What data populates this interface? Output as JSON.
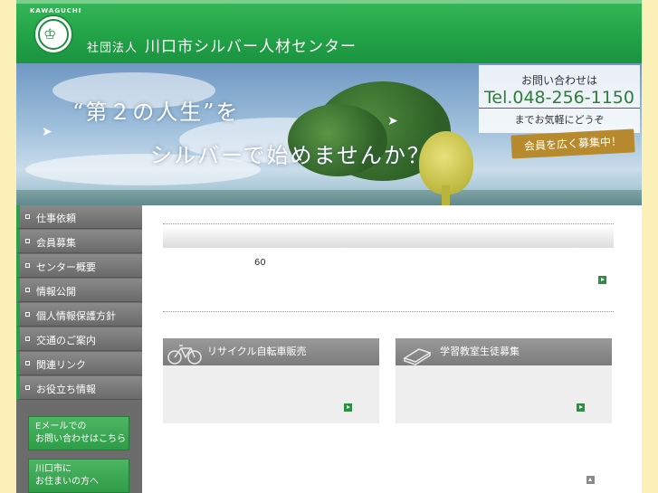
{
  "header": {
    "logo_text": "KAWAGUCHI",
    "org_prefix": "社団法人",
    "org_name": "川口市シルバー人材センター"
  },
  "hero": {
    "line1": "“第２の人生”を",
    "line2": "シルバーで始めませんか？",
    "contact_label": "お問い合わせは",
    "tel": "Tel.048-256-1150",
    "contact_note": "までお気軽にどうぞ",
    "recruit_banner": "会員を広く募集中！"
  },
  "sidebar": {
    "items": [
      {
        "label": "仕事依頼"
      },
      {
        "label": "会員募集"
      },
      {
        "label": "センター概要"
      },
      {
        "label": "情報公開"
      },
      {
        "label": "個人情報保護方針"
      },
      {
        "label": "交通のご案内"
      },
      {
        "label": "関連リンク"
      },
      {
        "label": "お役立ち情報"
      }
    ],
    "email_button": {
      "line1": "Eメールでの",
      "line2": "お問い合わせはこちら"
    },
    "resident_button": {
      "line1": "川口市に",
      "line2": "お住まいの方へ"
    }
  },
  "main": {
    "news_number": "60",
    "cards": [
      {
        "title": "リサイクル自転車販売",
        "icon": "bicycle-icon"
      },
      {
        "title": "学習教室生徒募集",
        "icon": "book-icon"
      }
    ]
  },
  "colors": {
    "brand_green": "#22a347",
    "page_background": "#fbf1b8",
    "nav_gray": "#6c6c6c",
    "banner_gold": "#b88a2e"
  }
}
